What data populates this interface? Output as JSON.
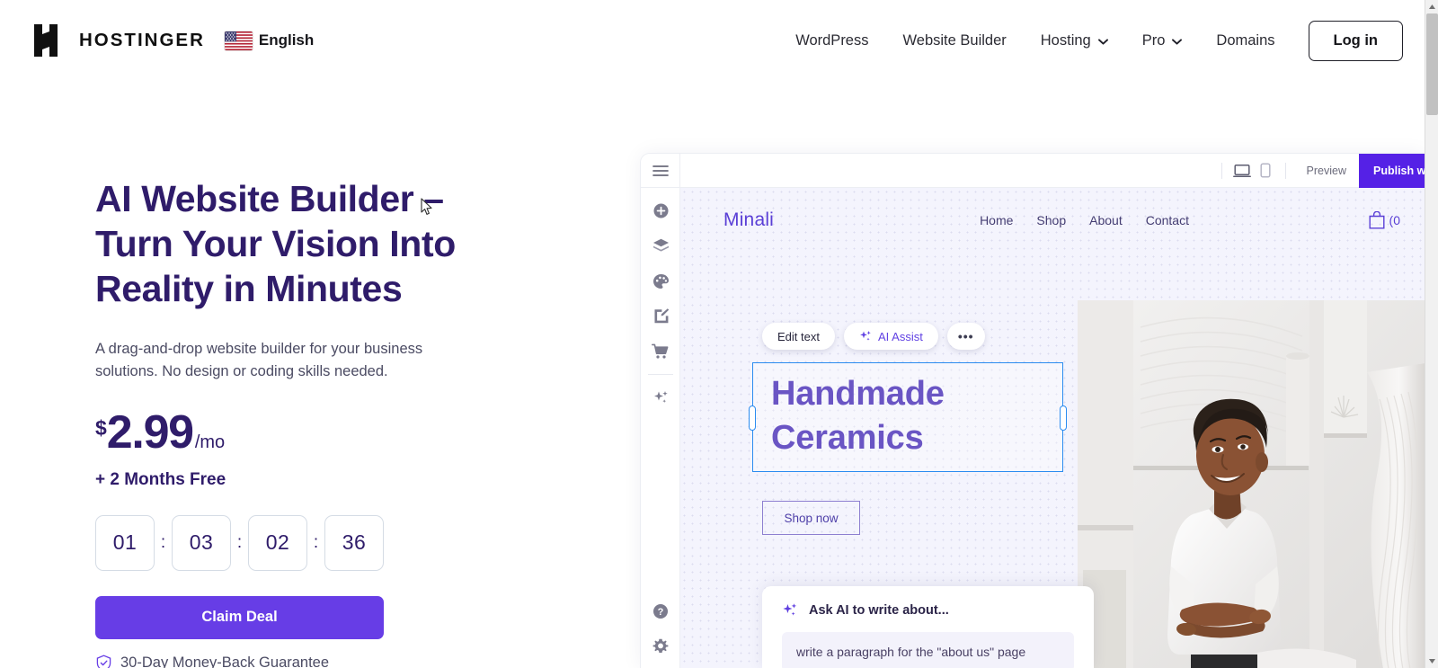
{
  "topnav": {
    "logo_text": "HOSTINGER",
    "language": "English",
    "links": [
      {
        "label": "WordPress",
        "has_chevron": false
      },
      {
        "label": "Website Builder",
        "has_chevron": false
      },
      {
        "label": "Hosting",
        "has_chevron": true
      },
      {
        "label": "Pro",
        "has_chevron": true
      },
      {
        "label": "Domains",
        "has_chevron": false
      }
    ],
    "login_label": "Log in"
  },
  "hero": {
    "title": "AI Website Builder –\nTurn Your Vision Into\nReality in Minutes",
    "subtitle": "A drag-and-drop website builder for your business\nsolutions. No design or coding skills needed.",
    "price_currency": "$",
    "price_amount": "2.99",
    "price_period": "/mo",
    "bonus": "+ 2 Months Free",
    "countdown": {
      "separator": ":",
      "units": [
        "01",
        "03",
        "02",
        "36"
      ]
    },
    "cta_label": "Claim Deal",
    "guarantee": "30-Day Money-Back Guarantee"
  },
  "builder": {
    "topbar": {
      "menu_icon": "hamburger-icon",
      "desktop_icon": "desktop-view-icon",
      "mobile_icon": "mobile-view-icon",
      "preview_label": "Preview",
      "publish_label": "Publish w"
    },
    "sidebar": {
      "items": [
        {
          "icon": "add-element-icon",
          "name": "add"
        },
        {
          "icon": "layers-icon",
          "name": "layers"
        },
        {
          "icon": "palette-icon",
          "name": "palette"
        },
        {
          "icon": "edit-page-icon",
          "name": "pages"
        },
        {
          "icon": "shopping-cart-icon",
          "name": "store"
        },
        {
          "icon": "ai-sparkle-icon",
          "name": "ai"
        }
      ],
      "bottom_items": [
        {
          "icon": "help-icon",
          "name": "help"
        },
        {
          "icon": "settings-gear-icon",
          "name": "settings"
        }
      ]
    },
    "site": {
      "logo": "Minali",
      "nav": [
        "Home",
        "Shop",
        "About",
        "Contact"
      ],
      "cart_count": "(0",
      "edit_toolbar": {
        "edit_text_label": "Edit text",
        "ai_assist_label": "AI Assist",
        "more_label": "•••"
      },
      "hero_heading": "Handmade\nCeramics",
      "shop_button": "Shop now",
      "ai_panel": {
        "title": "Ask AI to write about...",
        "input_value": "write a paragraph for the \"about us\" page"
      }
    }
  },
  "colors": {
    "brand_purple": "#673de6",
    "heading_purple": "#2f1c6a",
    "publish_purple": "#5521e6",
    "selection_blue": "#2b8cf0",
    "site_accent": "#5a3fd6"
  }
}
